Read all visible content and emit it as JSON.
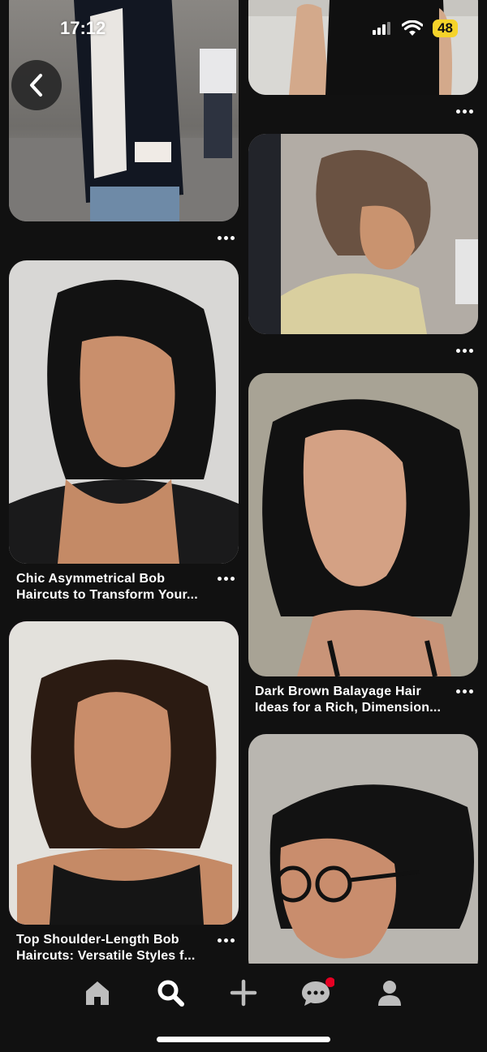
{
  "status_bar": {
    "time": "17:12",
    "battery": "48"
  },
  "pins": [
    {
      "title_lines": []
    },
    {
      "title_lines": []
    },
    {
      "title_lines": []
    },
    {
      "title_lines": [
        "Chic Asymmetrical Bob",
        "Haircuts to Transform Your..."
      ]
    },
    {
      "title_lines": [
        "Dark Brown Balayage Hair",
        "Ideas for a Rich, Dimension..."
      ]
    },
    {
      "title_lines": [
        "Top Shoulder-Length Bob",
        "Haircuts: Versatile Styles f..."
      ]
    },
    {
      "title_lines": []
    }
  ],
  "nav": {
    "items": [
      "home-icon",
      "search-icon",
      "create-icon",
      "messages-icon",
      "profile-icon"
    ],
    "active": "search-icon",
    "notification_color": "#e60023"
  },
  "colors": {
    "background": "#111111",
    "battery": "#f5d32a"
  }
}
